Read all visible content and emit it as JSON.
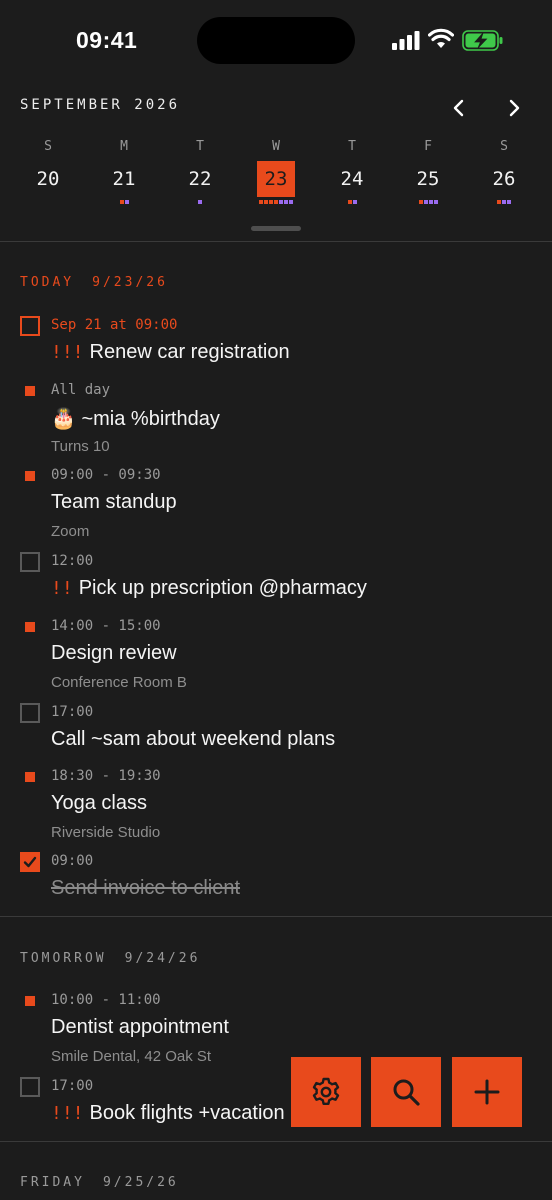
{
  "status_bar": {
    "time": "09:41"
  },
  "calendar": {
    "month_title": "SEPTEMBER 2026",
    "days": [
      {
        "letter": "S",
        "num": "20",
        "selected": false,
        "dots": ""
      },
      {
        "letter": "M",
        "num": "21",
        "selected": false,
        "dots": "op"
      },
      {
        "letter": "T",
        "num": "22",
        "selected": false,
        "dots": "p"
      },
      {
        "letter": "W",
        "num": "23",
        "selected": true,
        "dots": "ooooppp"
      },
      {
        "letter": "T",
        "num": "24",
        "selected": false,
        "dots": "op"
      },
      {
        "letter": "F",
        "num": "25",
        "selected": false,
        "dots": "oppp"
      },
      {
        "letter": "S",
        "num": "26",
        "selected": false,
        "dots": "opp"
      }
    ]
  },
  "sections": {
    "today": {
      "label": "TODAY",
      "date": "9/23/26"
    },
    "tomorrow": {
      "label": "TOMORROW",
      "date": "9/24/26"
    },
    "friday": {
      "label": "FRIDAY",
      "date": "9/25/26"
    }
  },
  "today_items": [
    {
      "marker": "box-overdue",
      "meta": "Sep 21 at 09:00",
      "priority": "!!!",
      "title": "Renew car registration",
      "sub": ""
    },
    {
      "marker": "square",
      "meta": "All day",
      "priority": "",
      "title": "🎂 ~mia %birthday",
      "sub": "Turns 10"
    },
    {
      "marker": "square",
      "meta": "09:00 - 09:30",
      "priority": "",
      "title": "Team standup",
      "sub": "Zoom"
    },
    {
      "marker": "box",
      "meta": "12:00",
      "priority": "!!",
      "title": "Pick up prescription @pharmacy",
      "sub": ""
    },
    {
      "marker": "square",
      "meta": "14:00 - 15:00",
      "priority": "",
      "title": "Design review",
      "sub": "Conference Room B"
    },
    {
      "marker": "box",
      "meta": "17:00",
      "priority": "",
      "title": "Call ~sam about weekend plans",
      "sub": ""
    },
    {
      "marker": "square",
      "meta": "18:30 - 19:30",
      "priority": "",
      "title": "Yoga class",
      "sub": "Riverside Studio"
    },
    {
      "marker": "box-checked",
      "meta": "09:00",
      "priority": "",
      "title": "Send invoice to client",
      "sub": ""
    }
  ],
  "tomorrow_items": [
    {
      "marker": "square",
      "meta": "10:00 - 11:00",
      "priority": "",
      "title": "Dentist appointment",
      "sub": "Smile Dental, 42 Oak St"
    },
    {
      "marker": "box",
      "meta": "17:00",
      "priority": "!!!",
      "title": "Book flights +vacation",
      "sub": ""
    }
  ],
  "actions": {
    "settings_icon": "gear-icon",
    "search_icon": "search-icon",
    "add_icon": "plus-icon"
  },
  "colors": {
    "accent": "#e84a1c",
    "purple": "#9b6cf0",
    "background": "#1c1c1c"
  }
}
